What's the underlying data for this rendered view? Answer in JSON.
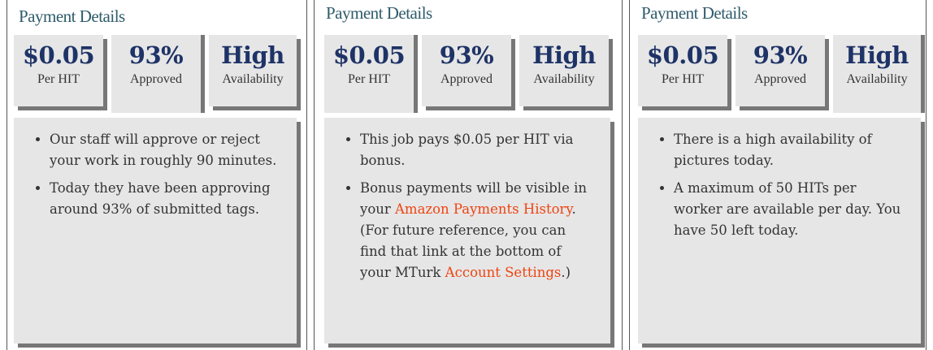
{
  "panels": [
    {
      "title": "Payment Details",
      "active_tab": 1,
      "tabs": [
        {
          "big": "$0.05",
          "small": "Per HIT"
        },
        {
          "big": "93%",
          "small": "Approved"
        },
        {
          "big": "High",
          "small": "Availability"
        }
      ],
      "bullets": [
        "Our staff will approve or reject your work in roughly 90 minutes.",
        "Today they have been approving around 93% of submitted tags."
      ]
    },
    {
      "title": "Payment Details",
      "active_tab": 0,
      "tabs": [
        {
          "big": "$0.05",
          "small": "Per HIT"
        },
        {
          "big": "93%",
          "small": "Approved"
        },
        {
          "big": "High",
          "small": "Availability"
        }
      ],
      "bullets": [
        "This job pays $0.05 per HIT via bonus.",
        {
          "pre": "Bonus payments will be visible in your ",
          "link1": "Amazon Payments History",
          "mid": ". (For future reference, you can find that link at the bottom of your MTurk ",
          "link2": "Account Settings",
          "post": ".)"
        }
      ]
    },
    {
      "title": "Payment Details",
      "active_tab": 2,
      "tabs": [
        {
          "big": "$0.05",
          "small": "Per HIT"
        },
        {
          "big": "93%",
          "small": "Approved"
        },
        {
          "big": "High",
          "small": "Availability"
        }
      ],
      "bullets": [
        "There is a high availability of pictures today.",
        "A maximum of 50 HITs per worker are available per day. You have 50 left today."
      ]
    }
  ],
  "colors": {
    "link": "#ee4411",
    "title": "#2f5c6b",
    "tab_value": "#1e3366"
  }
}
